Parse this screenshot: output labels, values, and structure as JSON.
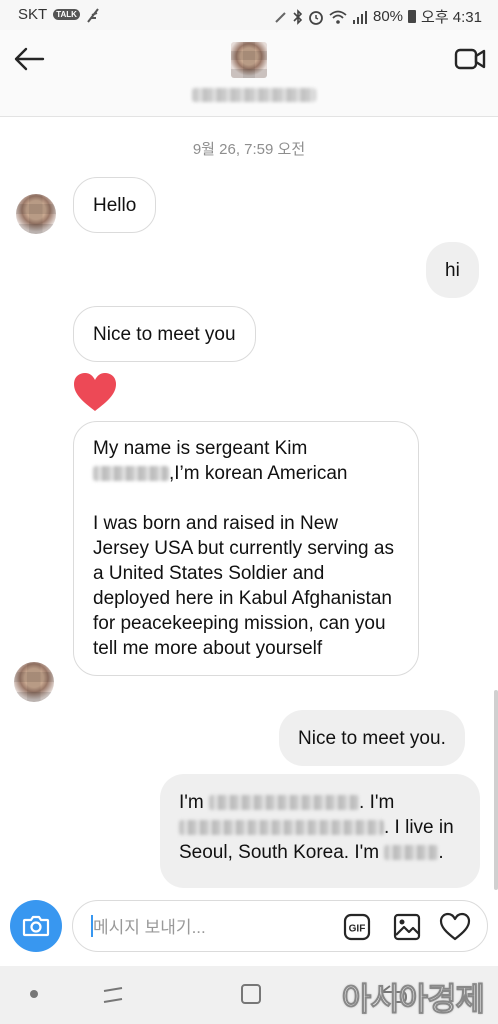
{
  "status_bar": {
    "carrier": "SKT",
    "talk_badge": "TALK",
    "battery": "80%",
    "time": "오후 4:31"
  },
  "header": {
    "back_icon": "arrow-left-icon",
    "video_icon": "video-camera-icon"
  },
  "conversation": {
    "timestamp": "9월 26, 7:59 오전",
    "messages": [
      {
        "sender": "them",
        "text": "Hello"
      },
      {
        "sender": "me",
        "text": "hi"
      },
      {
        "sender": "them",
        "text": "Nice to meet you"
      },
      {
        "sender": "them",
        "type": "reaction",
        "icon": "heart-icon",
        "color": "#ed4956"
      },
      {
        "sender": "them",
        "line1": "My name is sergeant Kim",
        "line2_suffix": ",I’m korean American",
        "paragraph2": "I was born and raised in New Jersey USA but currently serving as a United States Soldier and deployed here in Kabul Afghanistan for peacekeeping mission, can you tell me more about yourself"
      },
      {
        "sender": "me",
        "text": "Nice to meet you."
      },
      {
        "sender": "me",
        "part1": "I'm",
        "part2": ". I'm",
        "part3": ". I live in",
        "part4": "Seoul, South Korea. I'm",
        "part5": "."
      }
    ]
  },
  "composer": {
    "placeholder": "메시지 보내기...",
    "camera_color": "#3897f0",
    "icons": [
      "camera-icon",
      "gif-icon",
      "photo-icon",
      "heart-outline-icon"
    ]
  },
  "watermark": "아시아경제"
}
